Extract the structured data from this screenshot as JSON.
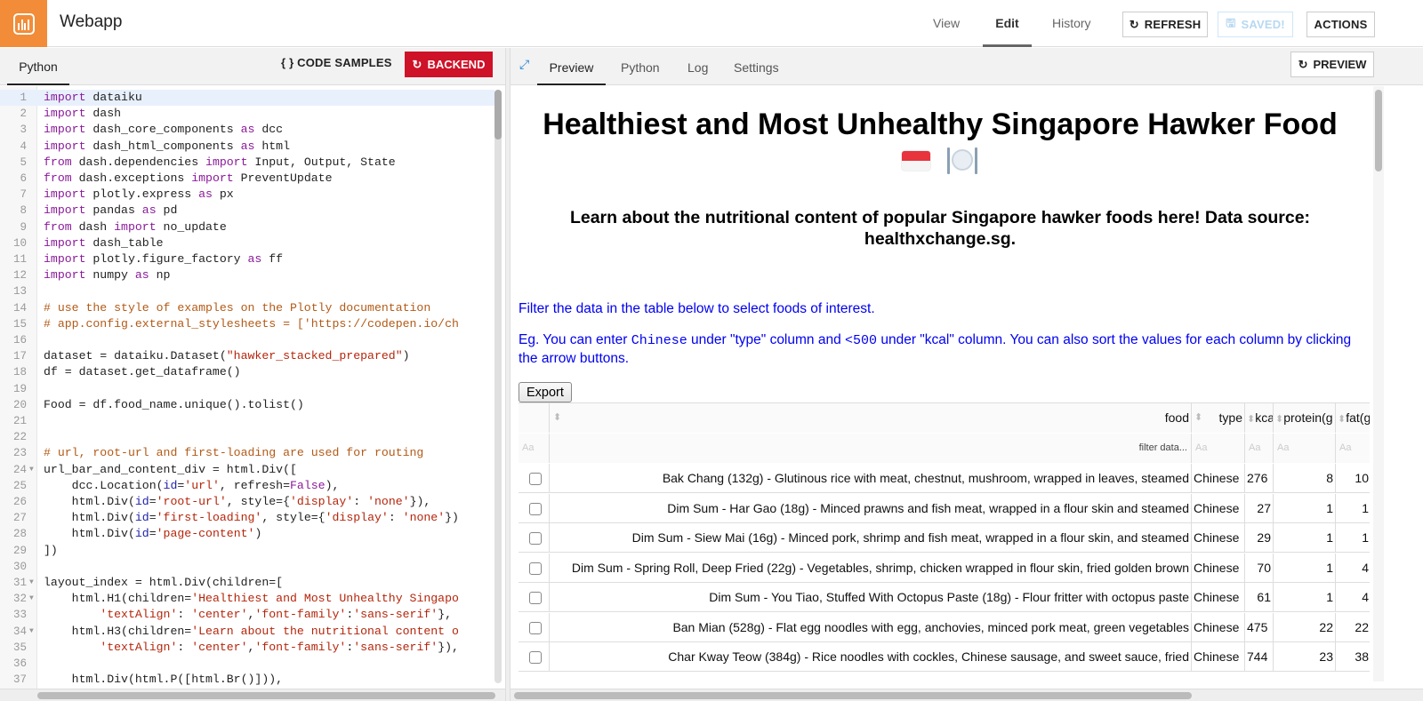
{
  "header": {
    "app_title": "Webapp",
    "logo_icon": "dataiku-webapp-icon",
    "nav": [
      {
        "label": "View",
        "active": false
      },
      {
        "label": "Edit",
        "active": true
      },
      {
        "label": "History",
        "active": false
      }
    ],
    "refresh_label": "REFRESH",
    "saved_label": "SAVED!",
    "actions_label": "ACTIONS"
  },
  "left_panel": {
    "tab_label": "Python",
    "code_samples_label": "CODE SAMPLES",
    "backend_label": "BACKEND",
    "colors": {
      "backend_bg": "#ce1228"
    },
    "code_lines": [
      {
        "n": "1",
        "fold": false,
        "html": "<span class=\"kw\">import</span> dataiku"
      },
      {
        "n": "2",
        "fold": false,
        "html": "<span class=\"kw\">import</span> dash"
      },
      {
        "n": "3",
        "fold": false,
        "html": "<span class=\"kw\">import</span> dash_core_components <span class=\"kw\">as</span> dcc"
      },
      {
        "n": "4",
        "fold": false,
        "html": "<span class=\"kw\">import</span> dash_html_components <span class=\"kw\">as</span> html"
      },
      {
        "n": "5",
        "fold": false,
        "html": "<span class=\"kw\">from</span> dash.dependencies <span class=\"kw\">import</span> Input, Output, State"
      },
      {
        "n": "6",
        "fold": false,
        "html": "<span class=\"kw\">from</span> dash.exceptions <span class=\"kw\">import</span> PreventUpdate"
      },
      {
        "n": "7",
        "fold": false,
        "html": "<span class=\"kw\">import</span> plotly.express <span class=\"kw\">as</span> px"
      },
      {
        "n": "8",
        "fold": false,
        "html": "<span class=\"kw\">import</span> pandas <span class=\"kw\">as</span> pd"
      },
      {
        "n": "9",
        "fold": false,
        "html": "<span class=\"kw\">from</span> dash <span class=\"kw\">import</span> no_update"
      },
      {
        "n": "10",
        "fold": false,
        "html": "<span class=\"kw\">import</span> dash_table"
      },
      {
        "n": "11",
        "fold": false,
        "html": "<span class=\"kw\">import</span> plotly.figure_factory <span class=\"kw\">as</span> ff"
      },
      {
        "n": "12",
        "fold": false,
        "html": "<span class=\"kw\">import</span> numpy <span class=\"kw\">as</span> np"
      },
      {
        "n": "13",
        "fold": false,
        "html": ""
      },
      {
        "n": "14",
        "fold": false,
        "html": "<span class=\"cm\"># use the style of examples on the Plotly documentation</span>"
      },
      {
        "n": "15",
        "fold": false,
        "html": "<span class=\"cm\"># app.config.external_stylesheets = ['https://codepen.io/ch</span>"
      },
      {
        "n": "16",
        "fold": false,
        "html": ""
      },
      {
        "n": "17",
        "fold": false,
        "html": "dataset = dataiku.Dataset(<span class=\"str\">\"hawker_stacked_prepared\"</span>)"
      },
      {
        "n": "18",
        "fold": false,
        "html": "df = dataset.get_dataframe()"
      },
      {
        "n": "19",
        "fold": false,
        "html": ""
      },
      {
        "n": "20",
        "fold": false,
        "html": "Food = df.food_name.unique().tolist()"
      },
      {
        "n": "21",
        "fold": false,
        "html": ""
      },
      {
        "n": "22",
        "fold": false,
        "html": ""
      },
      {
        "n": "23",
        "fold": false,
        "html": "<span class=\"cm\"># url, root-url and first-loading are used for routing</span>"
      },
      {
        "n": "24",
        "fold": true,
        "html": "url_bar_and_content_div = html.Div(["
      },
      {
        "n": "25",
        "fold": false,
        "html": "    dcc.Location(<span class=\"kwarg\">id</span>=<span class=\"str\">'url'</span>, refresh=<span class=\"const\">False</span>),"
      },
      {
        "n": "26",
        "fold": false,
        "html": "    html.Div(<span class=\"kwarg\">id</span>=<span class=\"str\">'root-url'</span>, style={<span class=\"str\">'display'</span>: <span class=\"str\">'none'</span>}),"
      },
      {
        "n": "27",
        "fold": false,
        "html": "    html.Div(<span class=\"kwarg\">id</span>=<span class=\"str\">'first-loading'</span>, style={<span class=\"str\">'display'</span>: <span class=\"str\">'none'</span>})"
      },
      {
        "n": "28",
        "fold": false,
        "html": "    html.Div(<span class=\"kwarg\">id</span>=<span class=\"str\">'page-content'</span>)"
      },
      {
        "n": "29",
        "fold": false,
        "html": "])"
      },
      {
        "n": "30",
        "fold": false,
        "html": ""
      },
      {
        "n": "31",
        "fold": true,
        "html": "layout_index = html.Div(children=["
      },
      {
        "n": "32",
        "fold": true,
        "html": "    html.H1(children=<span class=\"str\">'Healthiest and Most Unhealthy Singapo</span>"
      },
      {
        "n": "33",
        "fold": false,
        "html": "        <span class=\"str\">'textAlign'</span>: <span class=\"str\">'center'</span>,<span class=\"str\">'font-family'</span>:<span class=\"str\">'sans-serif'</span>},"
      },
      {
        "n": "34",
        "fold": true,
        "html": "    html.H3(children=<span class=\"str\">'Learn about the nutritional content o</span>"
      },
      {
        "n": "35",
        "fold": false,
        "html": "        <span class=\"str\">'textAlign'</span>: <span class=\"str\">'center'</span>,<span class=\"str\">'font-family'</span>:<span class=\"str\">'sans-serif'</span>}),"
      },
      {
        "n": "36",
        "fold": false,
        "html": ""
      },
      {
        "n": "37",
        "fold": false,
        "html": "    html.Div(html.P([html.Br()])),"
      }
    ]
  },
  "right_panel": {
    "tabs": [
      {
        "label": "Preview",
        "active": true
      },
      {
        "label": "Python",
        "active": false
      },
      {
        "label": "Log",
        "active": false
      },
      {
        "label": "Settings",
        "active": false
      }
    ],
    "preview_label": "PREVIEW",
    "page": {
      "title": "Healthiest and Most Unhealthy Singapore Hawker Food",
      "emoji_icons": [
        "singapore-flag-icon",
        "plate-fork-knife-icon"
      ],
      "subtitle": "Learn about the nutritional content of popular Singapore hawker foods here! Data source: healthxchange.sg.",
      "filter_instructions": "Filter the data in the table below to select foods of interest.",
      "example": {
        "part1": "Eg. You can enter ",
        "code1": "Chinese",
        "part2": " under \"type\" column and ",
        "code2": "<500",
        "part3": " under \"kcal\" column. You can also sort the values for each column by clicking the arrow buttons."
      },
      "text_color": "#0000f0",
      "export_label": "Export",
      "table": {
        "columns": [
          "food",
          "type",
          "kca",
          "protein(g",
          "fat(g"
        ],
        "filter_placeholders": {
          "food": "filter data...",
          "other": "Aa"
        },
        "rows": [
          {
            "food": "Bak Chang (132g) - Glutinous rice with meat, chestnut, mushroom, wrapped in leaves, steamed",
            "type": "Chinese",
            "kcal": "276",
            "protein": "8",
            "fat": "10"
          },
          {
            "food": "Dim Sum - Har Gao (18g) - Minced prawns and fish meat, wrapped in a flour skin and steamed",
            "type": "Chinese",
            "kcal": "27",
            "protein": "1",
            "fat": "1"
          },
          {
            "food": "Dim Sum - Siew Mai (16g) - Minced pork, shrimp and fish meat, wrapped in a flour skin, and steamed",
            "type": "Chinese",
            "kcal": "29",
            "protein": "1",
            "fat": "1"
          },
          {
            "food": "Dim Sum - Spring Roll, Deep Fried (22g) - Vegetables, shrimp, chicken wrapped in flour skin, fried golden brown",
            "type": "Chinese",
            "kcal": "70",
            "protein": "1",
            "fat": "4"
          },
          {
            "food": "Dim Sum - You Tiao, Stuffed With Octopus Paste (18g) - Flour fritter with octopus paste",
            "type": "Chinese",
            "kcal": "61",
            "protein": "1",
            "fat": "4"
          },
          {
            "food": "Ban Mian (528g) - Flat egg noodles with egg, anchovies, minced pork meat, green vegetables",
            "type": "Chinese",
            "kcal": "475",
            "protein": "22",
            "fat": "22"
          },
          {
            "food": "Char Kway Teow (384g) - Rice noodles with cockles, Chinese sausage, and sweet sauce, fried",
            "type": "Chinese",
            "kcal": "744",
            "protein": "23",
            "fat": "38"
          }
        ]
      }
    }
  }
}
